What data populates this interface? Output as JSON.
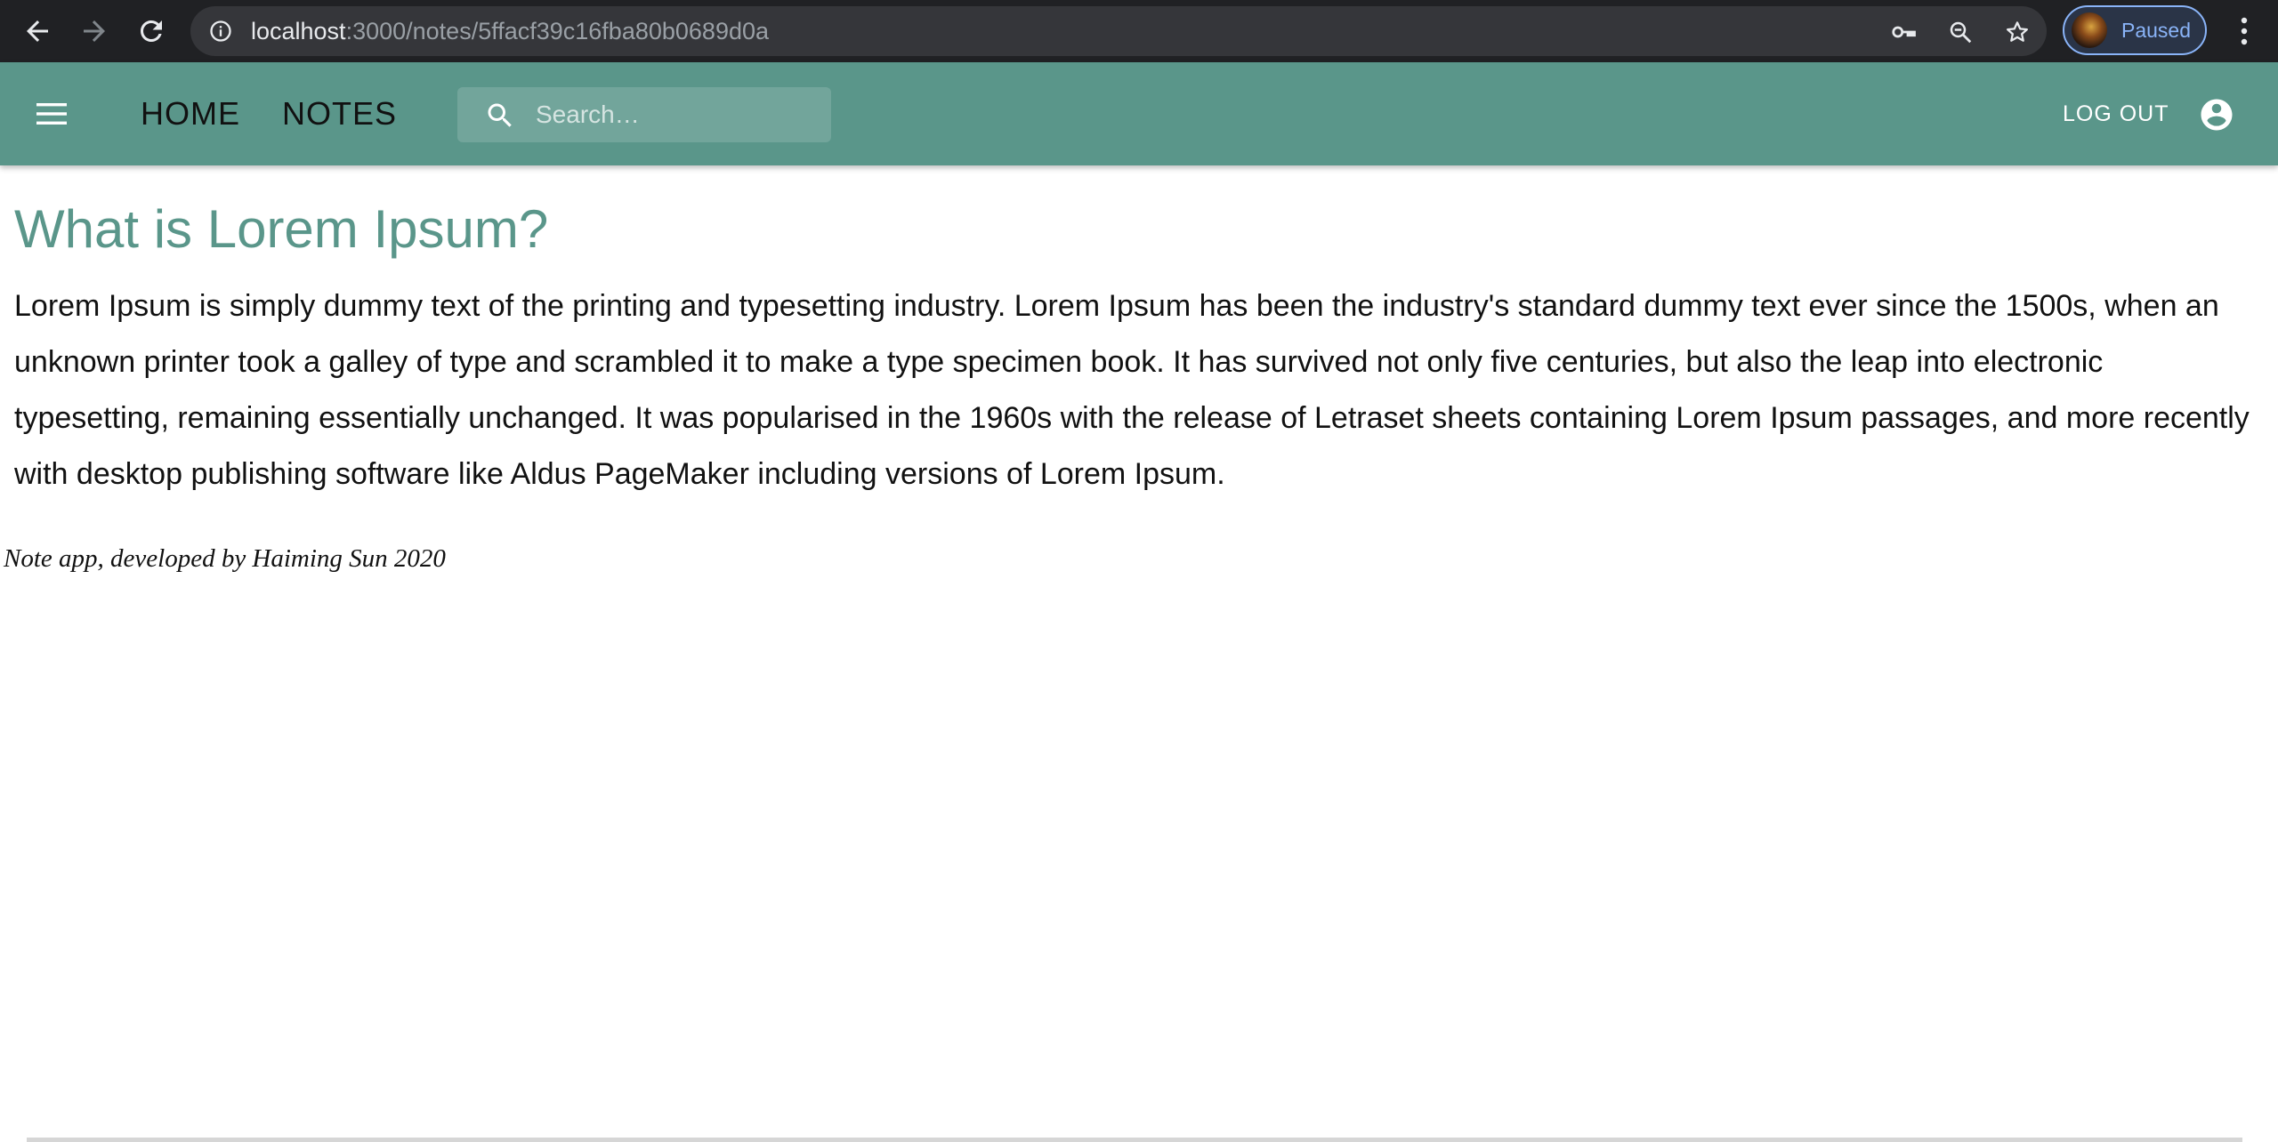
{
  "browser": {
    "url_host": "localhost",
    "url_path": ":3000/notes/5ffacf39c16fba80b0689d0a",
    "profile_status": "Paused",
    "icons": {
      "back": "back-arrow-icon",
      "forward": "forward-arrow-icon",
      "reload": "reload-icon",
      "site_info": "info-icon",
      "password": "key-icon",
      "zoom": "zoom-icon",
      "bookmark": "star-icon",
      "menu": "kebab-menu-icon"
    }
  },
  "app_bar": {
    "color": "#5a968a",
    "nav": {
      "home": "HOME",
      "notes": "NOTES"
    },
    "search": {
      "placeholder": "Search…",
      "value": ""
    },
    "logout_label": "LOG OUT"
  },
  "note": {
    "title": "What is Lorem Ipsum?",
    "body": "Lorem Ipsum is simply dummy text of the printing and typesetting industry. Lorem Ipsum has been the industry's standard dummy text ever since the 1500s, when an unknown printer took a galley of type and scrambled it to make a type specimen book. It has survived not only five centuries, but also the leap into electronic typesetting, remaining essentially unchanged. It was popularised in the 1960s with the release of Letraset sheets containing Lorem Ipsum passages, and more recently with desktop publishing software like Aldus PageMaker including versions of Lorem Ipsum."
  },
  "footer": {
    "text": "Note app, developed by Haiming Sun 2020"
  }
}
